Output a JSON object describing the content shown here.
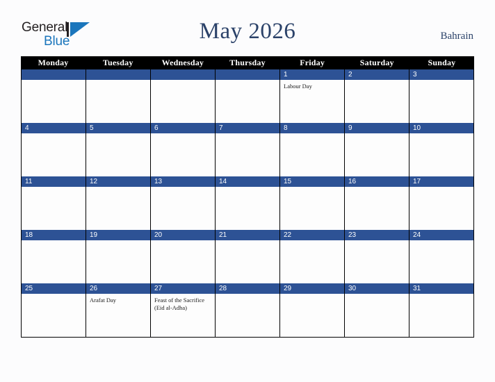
{
  "brand": {
    "line1": "General",
    "line2": "Blue",
    "triangle_icon": "triangle-right-icon",
    "line1_color": "#231f20",
    "line2_color": "#1b76bc"
  },
  "header": {
    "title": "May 2026",
    "country": "Bahrain",
    "title_color": "#2b4269"
  },
  "calendar": {
    "weekday_headers": [
      "Monday",
      "Tuesday",
      "Wednesday",
      "Thursday",
      "Friday",
      "Saturday",
      "Sunday"
    ],
    "header_bg": "#000000",
    "header_text_color": "#ffffff",
    "daynum_bg": "#2d5295",
    "daynum_text_color": "#ffffff",
    "cell_bg": "#fdfdfd",
    "weeks": [
      [
        {
          "day": "",
          "events": []
        },
        {
          "day": "",
          "events": []
        },
        {
          "day": "",
          "events": []
        },
        {
          "day": "",
          "events": []
        },
        {
          "day": "1",
          "events": [
            "Labour Day"
          ]
        },
        {
          "day": "2",
          "events": []
        },
        {
          "day": "3",
          "events": []
        }
      ],
      [
        {
          "day": "4",
          "events": []
        },
        {
          "day": "5",
          "events": []
        },
        {
          "day": "6",
          "events": []
        },
        {
          "day": "7",
          "events": []
        },
        {
          "day": "8",
          "events": []
        },
        {
          "day": "9",
          "events": []
        },
        {
          "day": "10",
          "events": []
        }
      ],
      [
        {
          "day": "11",
          "events": []
        },
        {
          "day": "12",
          "events": []
        },
        {
          "day": "13",
          "events": []
        },
        {
          "day": "14",
          "events": []
        },
        {
          "day": "15",
          "events": []
        },
        {
          "day": "16",
          "events": []
        },
        {
          "day": "17",
          "events": []
        }
      ],
      [
        {
          "day": "18",
          "events": []
        },
        {
          "day": "19",
          "events": []
        },
        {
          "day": "20",
          "events": []
        },
        {
          "day": "21",
          "events": []
        },
        {
          "day": "22",
          "events": []
        },
        {
          "day": "23",
          "events": []
        },
        {
          "day": "24",
          "events": []
        }
      ],
      [
        {
          "day": "25",
          "events": []
        },
        {
          "day": "26",
          "events": [
            "Arafat Day"
          ]
        },
        {
          "day": "27",
          "events": [
            "Feast of the Sacrifice (Eid al-Adha)"
          ]
        },
        {
          "day": "28",
          "events": []
        },
        {
          "day": "29",
          "events": []
        },
        {
          "day": "30",
          "events": []
        },
        {
          "day": "31",
          "events": []
        }
      ]
    ]
  }
}
